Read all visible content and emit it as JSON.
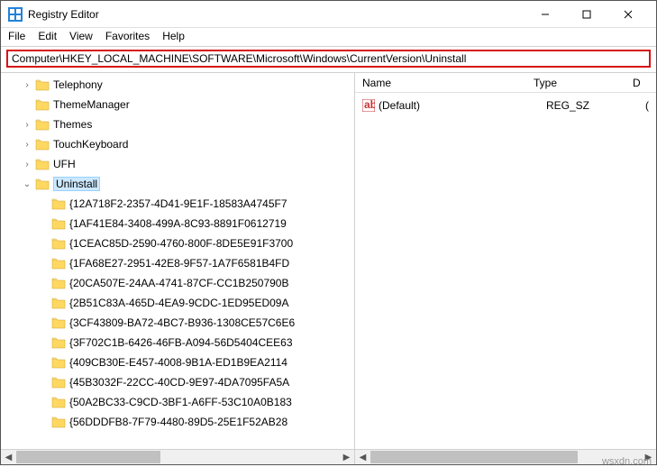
{
  "title": "Registry Editor",
  "menu": [
    "File",
    "Edit",
    "View",
    "Favorites",
    "Help"
  ],
  "address": "Computer\\HKEY_LOCAL_MACHINE\\SOFTWARE\\Microsoft\\Windows\\CurrentVersion\\Uninstall",
  "tree": {
    "level2": [
      {
        "label": "Telephony",
        "exp": ">"
      },
      {
        "label": "ThemeManager",
        "exp": ""
      },
      {
        "label": "Themes",
        "exp": ">"
      },
      {
        "label": "TouchKeyboard",
        "exp": ">"
      },
      {
        "label": "UFH",
        "exp": ">"
      }
    ],
    "uninstall": {
      "label": "Uninstall",
      "exp": "v"
    },
    "guids": [
      "{12A718F2-2357-4D41-9E1F-18583A4745F7",
      "{1AF41E84-3408-499A-8C93-8891F0612719",
      "{1CEAC85D-2590-4760-800F-8DE5E91F3700",
      "{1FA68E27-2951-42E8-9F57-1A7F6581B4FD",
      "{20CA507E-24AA-4741-87CF-CC1B250790B",
      "{2B51C83A-465D-4EA9-9CDC-1ED95ED09A",
      "{3CF43809-BA72-4BC7-B936-1308CE57C6E6",
      "{3F702C1B-6426-46FB-A094-56D5404CEE63",
      "{409CB30E-E457-4008-9B1A-ED1B9EA2114",
      "{45B3032F-22CC-40CD-9E97-4DA7095FA5A",
      "{50A2BC33-C9CD-3BF1-A6FF-53C10A0B183",
      "{56DDDFB8-7F79-4480-89D5-25E1F52AB28"
    ]
  },
  "cols": {
    "name": "Name",
    "type": "Type",
    "data": "D"
  },
  "values": [
    {
      "name": "(Default)",
      "type": "REG_SZ",
      "data": "("
    }
  ],
  "watermark": "wsxdn.com"
}
